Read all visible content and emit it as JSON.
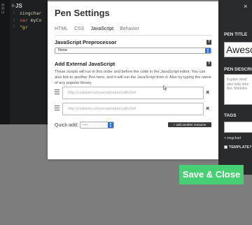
{
  "editor": {
    "css_label": "CSS",
    "js_label": "JS",
    "lines": [
      {
        "num": "1",
        "parts": [
          {
            "cls": "id",
            "text": "zingchar"
          }
        ]
      },
      {
        "num": "2",
        "parts": [
          {
            "cls": "kw",
            "text": "var "
          },
          {
            "cls": "id",
            "text": "myCo"
          }
        ]
      },
      {
        "num": "3",
        "parts": [
          {
            "cls": "str",
            "text": "  \"gr"
          }
        ]
      }
    ]
  },
  "modal": {
    "title": "Pen Settings",
    "tabs": [
      "HTML",
      "CSS",
      "JavaScript",
      "Behavior"
    ],
    "active_tab": "JavaScript",
    "preprocessor": {
      "heading": "JavaScript Preprocessor",
      "help": "?",
      "selected": "None"
    },
    "external": {
      "heading": "Add External JavaScript",
      "help": "?",
      "description": "These scripts will run in this order and before the code in the JavaScript editor. You can also link to another Pen here, and it will run the JavaScript from it. Also try typing the name of any popular library.",
      "placeholder": "http://codepen.io/username/pen/aBcDef",
      "remove": "×"
    },
    "quick_add": {
      "label": "Quick-add:",
      "selected": "----"
    },
    "add_another": "+ add another resource"
  },
  "sidebar": {
    "pen_title_heading": "PEN TITLE",
    "pen_title_value": "Aweso",
    "pen_description_heading": "PEN DESCRI",
    "pen_description_placeholder": [
      "Explain what'",
      "also help othe",
      "like. Markdov"
    ],
    "tags_heading": "TAGS",
    "tag": "zingchart",
    "tag_remove": "×",
    "template_label": "TEMPLATE?"
  },
  "save_button": "Save & Close",
  "colors": {
    "save": "#47cf73",
    "select_arrow": "#2f6fd6",
    "panel": "#2a2b2d",
    "editor": "#1d1f20"
  }
}
